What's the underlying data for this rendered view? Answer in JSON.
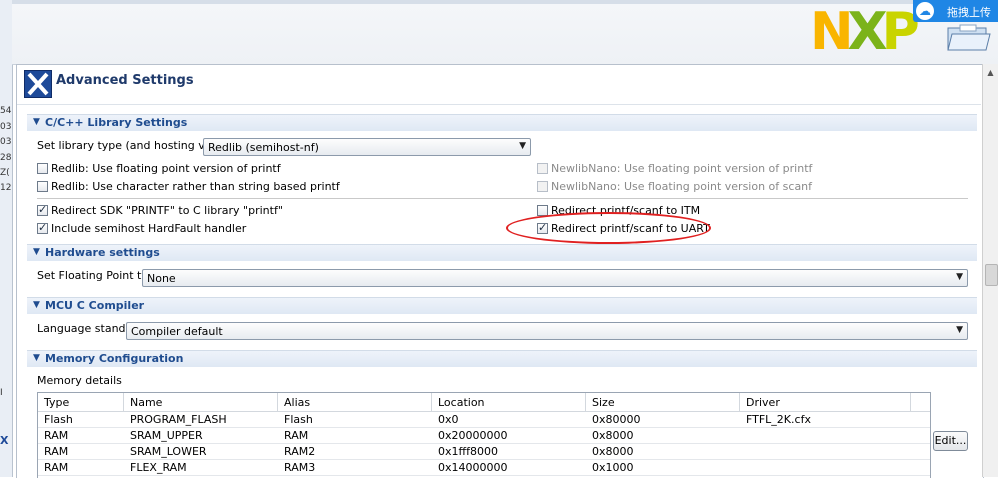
{
  "edge_chars": [
    "54",
    "03",
    "03",
    "28",
    "Z(",
    "12",
    "Ι",
    "X"
  ],
  "upload": {
    "label": "拖拽上传",
    "icon": "cloud-icon"
  },
  "logo_text": {
    "n": "N",
    "x": "X",
    "p": "P"
  },
  "header": {
    "title": "Advanced Settings",
    "icon": "x-logo-icon"
  },
  "library": {
    "section_title": "C/C++ Library Settings",
    "type_label": "Set library type (and hosting variant)",
    "type_value": "Redlib (semihost-nf)",
    "options_left": [
      {
        "label": "Redlib: Use floating point version of printf",
        "checked": false
      },
      {
        "label": "Redlib: Use character rather than string based printf",
        "checked": false
      }
    ],
    "options_right": [
      {
        "label": "NewlibNano: Use floating point version of printf",
        "checked": false,
        "disabled": true
      },
      {
        "label": "NewlibNano: Use floating point version of scanf",
        "checked": false,
        "disabled": true
      }
    ],
    "redirect_sdk": {
      "label": "Redirect SDK \"PRINTF\" to C library \"printf\"",
      "checked": true
    },
    "semihost_hardfault": {
      "label": "Include semihost HardFault handler",
      "checked": true
    },
    "redirect_itm": {
      "label": "Redirect printf/scanf to ITM",
      "checked": false
    },
    "redirect_uart": {
      "label": "Redirect printf/scanf to UART",
      "checked": true
    }
  },
  "hardware": {
    "section_title": "Hardware settings",
    "fp_label": "Set Floating Point type",
    "fp_value": "None"
  },
  "compiler": {
    "section_title": "MCU C Compiler",
    "lang_label": "Language standard",
    "lang_value": "Compiler default"
  },
  "memory": {
    "section_title": "Memory Configuration",
    "details_label": "Memory details",
    "columns": [
      "Type",
      "Name",
      "Alias",
      "Location",
      "Size",
      "Driver"
    ],
    "rows": [
      [
        "Flash",
        "PROGRAM_FLASH",
        "Flash",
        "0x0",
        "0x80000",
        "FTFL_2K.cfx"
      ],
      [
        "RAM",
        "SRAM_UPPER",
        "RAM",
        "0x20000000",
        "0x8000",
        ""
      ],
      [
        "RAM",
        "SRAM_LOWER",
        "RAM2",
        "0x1fff8000",
        "0x8000",
        ""
      ],
      [
        "RAM",
        "FLEX_RAM",
        "RAM3",
        "0x14000000",
        "0x1000",
        ""
      ]
    ],
    "edit_label": "Edit..."
  }
}
